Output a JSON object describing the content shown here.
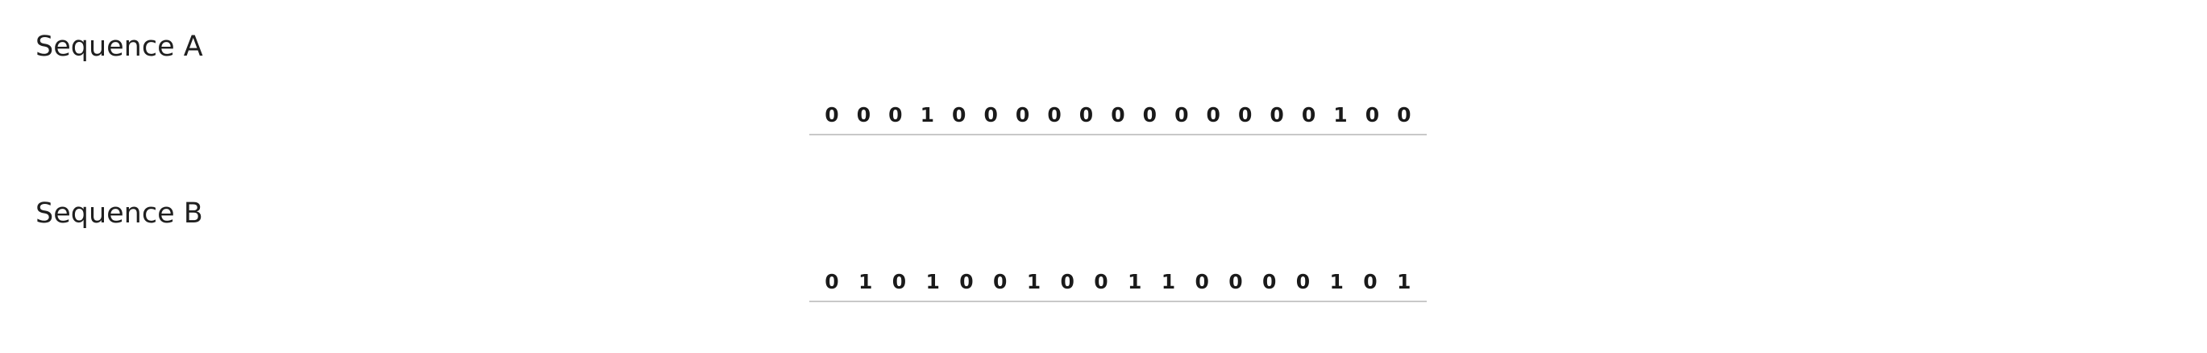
{
  "sequences": [
    {
      "title": "Sequence A",
      "bits": [
        "0",
        "0",
        "0",
        "1",
        "0",
        "0",
        "0",
        "0",
        "0",
        "0",
        "0",
        "0",
        "0",
        "0",
        "0",
        "0",
        "1",
        "0",
        "0"
      ]
    },
    {
      "title": "Sequence B",
      "bits": [
        "0",
        "1",
        "0",
        "1",
        "0",
        "0",
        "1",
        "0",
        "0",
        "1",
        "1",
        "0",
        "0",
        "0",
        "0",
        "1",
        "0",
        "1"
      ]
    }
  ]
}
